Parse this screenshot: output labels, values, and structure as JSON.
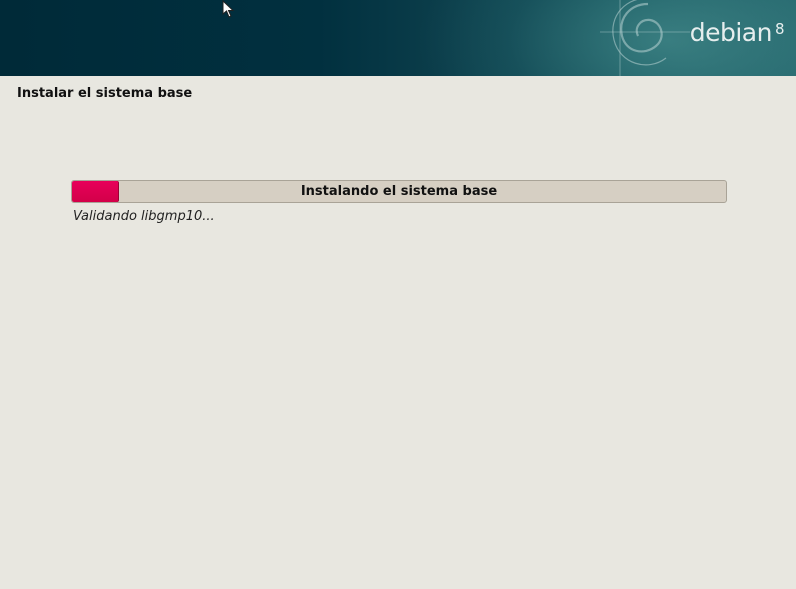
{
  "banner": {
    "brand": "debian",
    "version": "8",
    "logo_icon": "debian-swirl-icon"
  },
  "page": {
    "title": "Instalar el sistema base"
  },
  "progress": {
    "label": "Instalando el sistema base",
    "fraction": 0.07,
    "fill_color": "#e0004f",
    "status": "Validando libgmp10..."
  },
  "colors": {
    "background": "#e8e7e0",
    "banner": "#002a38",
    "bar_track": "#d6cfc3"
  },
  "cursor": {
    "icon": "mouse-pointer-icon"
  }
}
